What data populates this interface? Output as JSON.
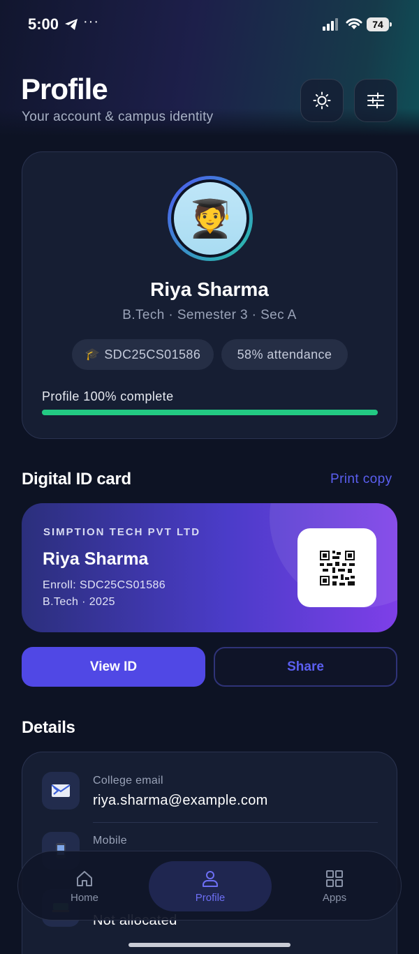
{
  "status_bar": {
    "time": "5:00",
    "battery": "74",
    "more": "···"
  },
  "header": {
    "title": "Profile",
    "subtitle": "Your account & campus identity"
  },
  "profile": {
    "name": "Riya Sharma",
    "program": "B.Tech · Semester 3 · Sec A",
    "enrollment_chip": "SDC25CS01586",
    "attendance_chip": "58% attendance",
    "progress_label": "Profile 100% complete",
    "progress": 1.0,
    "progress_color": "#23c983"
  },
  "id_section": {
    "title": "Digital ID card",
    "print_link": "Print copy"
  },
  "id_card": {
    "company": "SIMPTION TECH PVT LTD",
    "name": "Riya Sharma",
    "enroll_line": "Enroll: SDC25CS01586",
    "program_line": "B.Tech · 2025"
  },
  "actions": {
    "view_label": "View ID",
    "share_label": "Share"
  },
  "details": {
    "title": "Details",
    "items": [
      {
        "label": "College email",
        "value": "riya.sharma@example.com",
        "icon": "email-icon"
      },
      {
        "label": "Mobile",
        "value": "",
        "icon": "phone-icon"
      },
      {
        "label": "",
        "value": "Not allocated",
        "icon": "room-icon"
      }
    ]
  },
  "nav": {
    "items": [
      {
        "label": "Home",
        "icon": "home-icon"
      },
      {
        "label": "Profile",
        "icon": "profile-icon",
        "active": true
      },
      {
        "label": "Apps",
        "icon": "apps-grid-icon"
      }
    ]
  },
  "colors": {
    "accent": "#5048e5",
    "link": "#5b5ff0",
    "success": "#23c983",
    "background": "#0d1324"
  }
}
